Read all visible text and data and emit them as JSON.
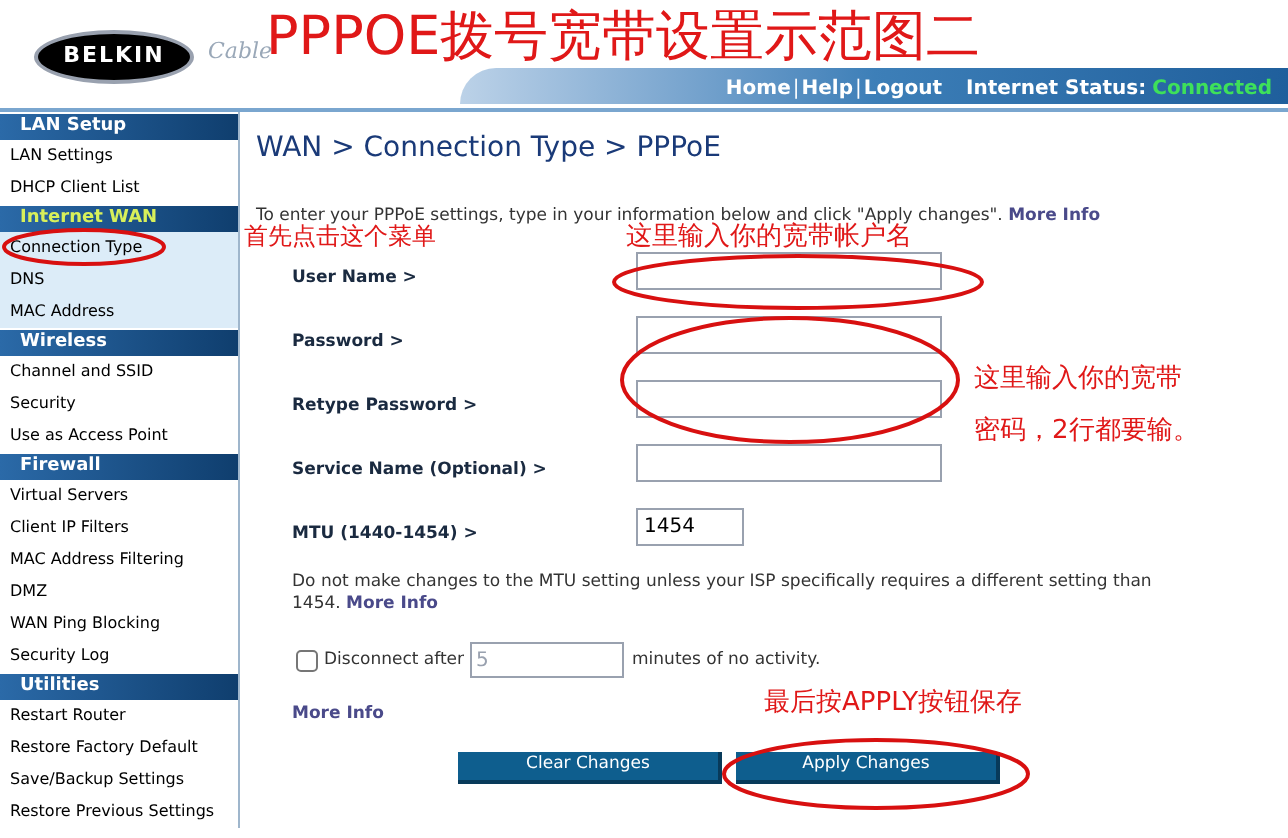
{
  "header": {
    "logo": "BELKIN",
    "tagline": "Cable",
    "links": [
      "Home",
      "Help",
      "Logout"
    ],
    "link_separator": "|",
    "status_label": "Internet Status:",
    "status_value": "Connected",
    "connected": true
  },
  "sidebar": {
    "sections": [
      {
        "title": "LAN Setup",
        "selected": false,
        "items": [
          "LAN Settings",
          "DHCP Client List"
        ]
      },
      {
        "title": "Internet WAN",
        "selected": true,
        "items": [
          "Connection Type",
          "DNS",
          "MAC Address"
        ]
      },
      {
        "title": "Wireless",
        "selected": false,
        "items": [
          "Channel and SSID",
          "Security",
          "Use as Access Point"
        ]
      },
      {
        "title": "Firewall",
        "selected": false,
        "items": [
          "Virtual Servers",
          "Client IP Filters",
          "MAC Address Filtering",
          "DMZ",
          "WAN Ping Blocking",
          "Security Log"
        ]
      },
      {
        "title": "Utilities",
        "selected": false,
        "items": [
          "Restart Router",
          "Restore Factory Default",
          "Save/Backup Settings",
          "Restore Previous Settings"
        ]
      }
    ]
  },
  "main": {
    "title": "WAN > Connection Type > PPPoE",
    "intro": "To enter your PPPoE settings, type in your information below and click \"Apply changes\".",
    "intro_link": "More Info",
    "fields": [
      {
        "label": "User Name >"
      },
      {
        "label": "Password >"
      },
      {
        "label": "Retype Password >"
      },
      {
        "label": "Service Name (Optional) >"
      },
      {
        "label": "MTU (1440-1454) >",
        "value": "1454"
      }
    ],
    "mtu_note": "Do not make changes to the MTU setting unless your ISP specifically requires a different setting than 1454.",
    "mtu_note_link": "More Info",
    "disconnect": {
      "checked": false,
      "label": "Disconnect after",
      "value": "5",
      "disabled": true,
      "suffix": "minutes of no activity."
    },
    "more_info": "More Info",
    "buttons": [
      "Clear Changes",
      "Apply Changes"
    ]
  },
  "annotations": [
    {
      "kind": "title",
      "text": "PPPOE拨号宽带设置示范图二"
    },
    {
      "kind": "menu",
      "text": "首先点击这个菜单"
    },
    {
      "kind": "user",
      "text": "这里输入你的宽带帐户名"
    },
    {
      "kind": "password",
      "text": "这里输入你的宽带"
    },
    {
      "kind": "password2",
      "text": "密码，2行都要输。"
    },
    {
      "kind": "apply",
      "text": "最后按APPLY按钮保存"
    }
  ]
}
